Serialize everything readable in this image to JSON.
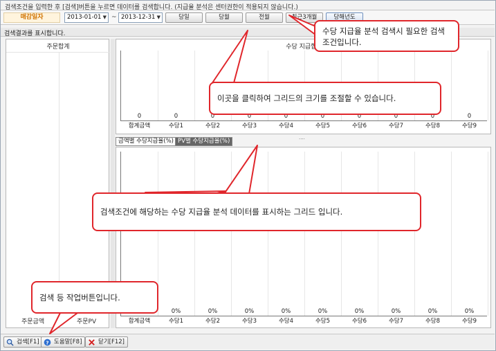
{
  "notice": "검색조건을 입력한 후 [검색]버튼을 누르면 데이터를 검색합니다. (지급율 분석은 센터권한이 적용되지 않습니다.)",
  "filter": {
    "label": "매감일자",
    "date_from": "2013-01-01",
    "tilde": "~",
    "date_to": "2013-12-31",
    "buttons": [
      "당일",
      "당월",
      "전월",
      "최근3개월",
      "당해년도"
    ]
  },
  "result_label": "검색결과를 표시합니다.",
  "left_panel": {
    "title": "주문합계",
    "cap_left": "주문금액",
    "cap_right": "주문PV"
  },
  "top_chart": {
    "title": "수당 지급합계"
  },
  "tabs": [
    "금액별 수당지급율(%)",
    "PV별 수당지급율(%)"
  ],
  "chart_data": [
    {
      "type": "bar",
      "title": "수당 지급합계",
      "categories": [
        "합계금액",
        "수당1",
        "수당2",
        "수당3",
        "수당4",
        "수당5",
        "수당6",
        "수당7",
        "수당8",
        "수당9"
      ],
      "values": [
        0,
        0,
        0,
        0,
        0,
        0,
        0,
        0,
        0,
        0
      ],
      "value_labels": [
        "0",
        "0",
        "0",
        "0",
        "0",
        "0",
        "0",
        "0",
        "0",
        "0"
      ]
    },
    {
      "type": "bar",
      "title": "금액별 수당지급율(%)",
      "categories": [
        "합계금액",
        "수당1",
        "수당2",
        "수당3",
        "수당4",
        "수당5",
        "수당6",
        "수당7",
        "수당8",
        "수당9"
      ],
      "values": [
        0,
        0,
        0,
        0,
        0,
        0,
        0,
        0,
        0,
        0
      ],
      "value_labels": [
        "0%",
        "0%",
        "0%",
        "0%",
        "0%",
        "0%",
        "0%",
        "0%",
        "0%",
        "0%"
      ]
    }
  ],
  "bottom_buttons": [
    {
      "label": "검색[F1]",
      "icon": "search-icon"
    },
    {
      "label": "도움말[F8]",
      "icon": "help-icon"
    },
    {
      "label": "닫기[F12]",
      "icon": "close-icon"
    }
  ],
  "callouts": {
    "search_condition": "수당 지급율 분석 검색시 필요한 검색조건입니다.",
    "resize": "이곳을 클릭하여 그리드의 크기를 조절할 수 있습니다.",
    "grid": "검색조건에 해당하는 수당 지급율 분석 데이터를 표시하는 그리드 입니다.",
    "buttons": "검색 등 작업버튼입니다."
  },
  "colors": {
    "callout_border": "#e0262b",
    "filter_label_text": "#d07300",
    "tab_inactive_bg": "#666666"
  }
}
